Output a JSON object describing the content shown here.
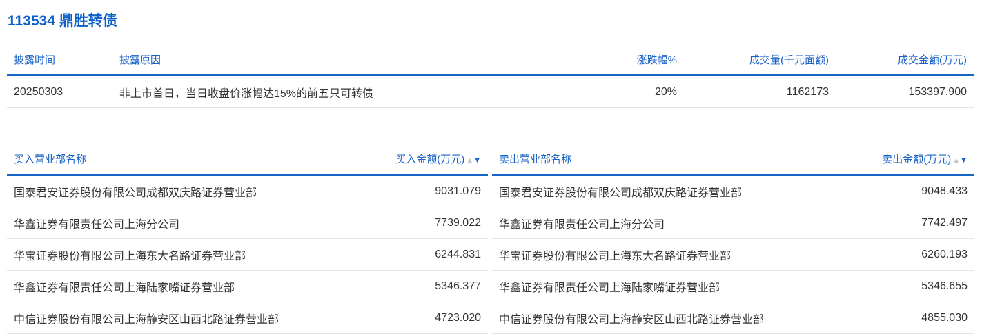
{
  "title": "113534 鼎胜转债",
  "disclosure": {
    "headers": [
      "披露时间",
      "披露原因",
      "涨跌幅%",
      "成交量(千元面额)",
      "成交金额(万元)"
    ],
    "row": {
      "date": "20250303",
      "reason": "非上市首日，当日收盘价涨幅达15%的前五只可转债",
      "change": "20%",
      "volume": "1162173",
      "amount": "153397.900"
    }
  },
  "buy": {
    "headers": [
      "买入营业部名称",
      "买入金额(万元)"
    ],
    "rows": [
      {
        "name": "国泰君安证券股份有限公司成都双庆路证券营业部",
        "amount": "9031.079"
      },
      {
        "name": "华鑫证券有限责任公司上海分公司",
        "amount": "7739.022"
      },
      {
        "name": "华宝证券股份有限公司上海东大名路证券营业部",
        "amount": "6244.831"
      },
      {
        "name": "华鑫证券有限责任公司上海陆家嘴证券营业部",
        "amount": "5346.377"
      },
      {
        "name": "中信证券股份有限公司上海静安区山西北路证券营业部",
        "amount": "4723.020"
      }
    ]
  },
  "sell": {
    "headers": [
      "卖出营业部名称",
      "卖出金额(万元)"
    ],
    "rows": [
      {
        "name": "国泰君安证券股份有限公司成都双庆路证券营业部",
        "amount": "9048.433"
      },
      {
        "name": "华鑫证券有限责任公司上海分公司",
        "amount": "7742.497"
      },
      {
        "name": "华宝证券股份有限公司上海东大名路证券营业部",
        "amount": "6260.193"
      },
      {
        "name": "华鑫证券有限责任公司上海陆家嘴证券营业部",
        "amount": "5346.655"
      },
      {
        "name": "中信证券股份有限公司上海静安区山西北路证券营业部",
        "amount": "4855.030"
      }
    ]
  }
}
